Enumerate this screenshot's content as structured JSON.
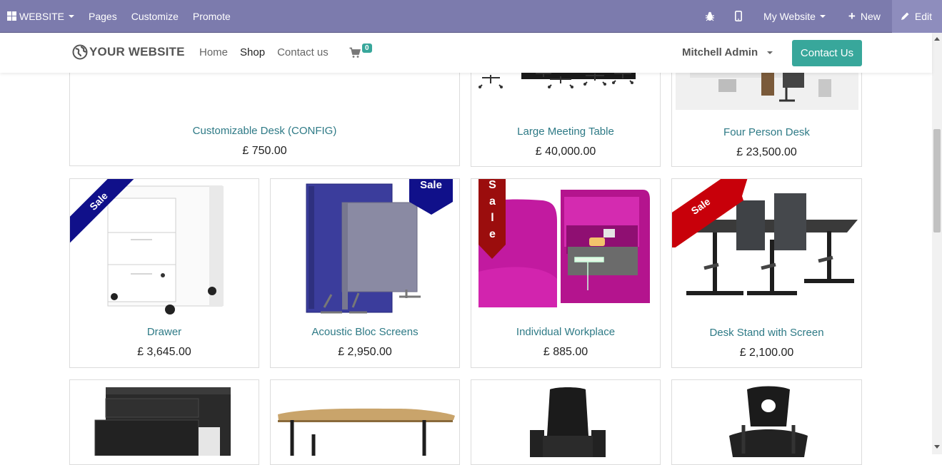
{
  "editbar": {
    "website_menu": "WEBSITE",
    "pages": "Pages",
    "customize": "Customize",
    "promote": "Promote",
    "my_website": "My Website",
    "new": "New",
    "edit": "Edit"
  },
  "header": {
    "logo_text": "YOUR WEBSITE",
    "nav": [
      "Home",
      "Shop",
      "Contact us"
    ],
    "cart_count": "0",
    "user": "Mitchell Admin",
    "contact_button": "Contact Us"
  },
  "products": [
    {
      "name": "Customizable Desk (CONFIG)",
      "price": "£ 750.00"
    },
    {
      "name": "Large Meeting Table",
      "price": "£ 40,000.00"
    },
    {
      "name": "Four Person Desk",
      "price": "£ 23,500.00"
    },
    {
      "name": "Drawer",
      "price": "£ 3,645.00",
      "ribbon": "Sale"
    },
    {
      "name": "Acoustic Bloc Screens",
      "price": "£ 2,950.00",
      "ribbon": "Sale"
    },
    {
      "name": "Individual Workplace",
      "price": "£ 885.00",
      "ribbon": "Sale"
    },
    {
      "name": "Desk Stand with Screen",
      "price": "£ 2,100.00",
      "ribbon": "Sale"
    }
  ],
  "colors": {
    "editbar": "#7c7bad",
    "accent": "#38a79b",
    "product_link": "#2e7a86",
    "ribbon_blue": "#10108a",
    "ribbon_darkred": "#9b0d0d",
    "ribbon_red": "#c8000a"
  }
}
